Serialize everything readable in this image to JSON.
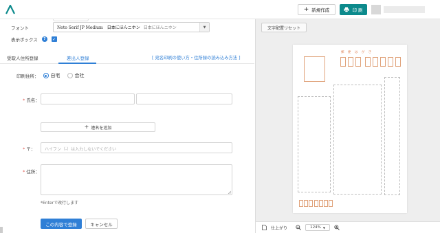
{
  "header": {
    "new_label": "新規作成",
    "print_label": "印 刷",
    "accent_color": "#0c8a8c"
  },
  "settings": {
    "font_label": "フォント",
    "font_name": "Noto Serif JP Medium　日本にほんニホン",
    "font_preview": "日本にほんニホン",
    "show_box_label": "表示ボックス"
  },
  "tabs": [
    {
      "label": "受取人住所登録"
    },
    {
      "label": "差出人登録"
    }
  ],
  "help_link": "[ 宛名印刷の使い方・住所録の読み込み方法 ]",
  "form": {
    "print_address_label": "印刷住所：",
    "options": [
      "自宅",
      "会社"
    ],
    "name_label": "氏名：",
    "add_joint_label": "連名を追加",
    "zip_label": "〒：",
    "zip_placeholder": "ハイフン（-）は入力しないでください",
    "address_label": "住所：",
    "hint": "*Enterで改行します",
    "submit_label": "この内容で登録",
    "cancel_label": "キャンセル",
    "required_mark": "*"
  },
  "preview": {
    "reset_label": "文字配置リセット",
    "zip_caption": "郵 便 は が き",
    "finish_label": "仕上がり",
    "zoom_value": "124%"
  }
}
